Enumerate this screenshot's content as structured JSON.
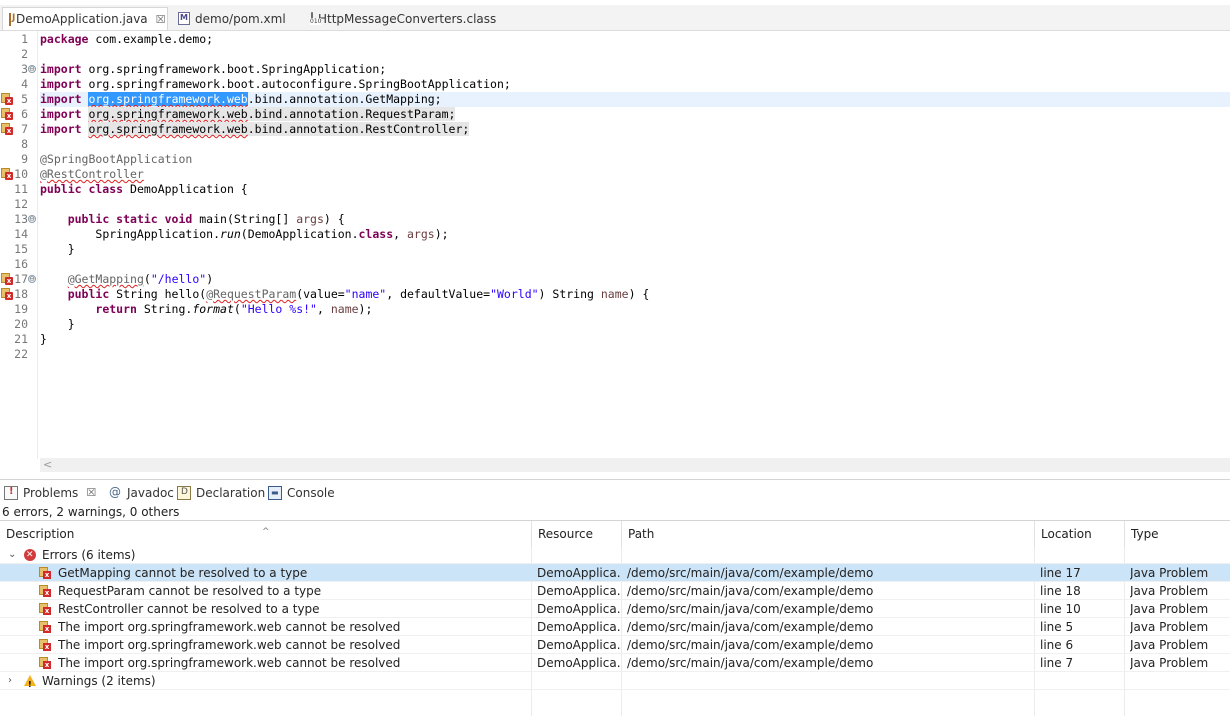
{
  "editor_tabs": [
    {
      "label": "DemoApplication.java",
      "icon": "java-file-icon",
      "active": true,
      "close": "☒"
    },
    {
      "label": "demo/pom.xml",
      "icon": "maven-file-icon",
      "active": false
    },
    {
      "label": "HttpMessageConverters.class",
      "icon": "class-file-icon",
      "active": false
    }
  ],
  "code": {
    "line_numbers": [
      "1",
      "2",
      "3",
      "4",
      "5",
      "6",
      "7",
      "8",
      "9",
      "10",
      "11",
      "12",
      "13",
      "14",
      "15",
      "16",
      "17",
      "18",
      "19",
      "20",
      "21",
      "22"
    ],
    "l1_kw": "package",
    "l1_rest": " com.example.demo;",
    "l3_kw": "import",
    "l3_rest": " org.springframework.boot.SpringApplication;",
    "l4_kw": "import",
    "l4_rest": " org.springframework.boot.autoconfigure.SpringBootApplication;",
    "l5_kw": "import",
    "l5_sel": "org.springframework.web",
    "l5_rest": ".bind.annotation.GetMapping;",
    "l6_kw": "import",
    "l6_err": "org.springframework.web",
    "l6_rest": ".bind.annotation.RequestParam;",
    "l7_kw": "import",
    "l7_err": "org.springframework.web",
    "l7_rest": ".bind.annotation.RestController;",
    "l9": "@SpringBootApplication",
    "l10": "@RestController",
    "l11_kw": "public class",
    "l11_rest": " DemoApplication {",
    "l13_kw": "public static void",
    "l13_rest": " main(String[] ",
    "l13_var": "args",
    "l13_end": ") {",
    "l14_a": "SpringApplication.",
    "l14_it": "run",
    "l14_b": "(DemoApplication.",
    "l14_kw": "class",
    "l14_c": ", ",
    "l14_var": "args",
    "l14_d": ");",
    "l15": "}",
    "l17_ann": "@GetMapping",
    "l17_b": "(",
    "l17_str": "\"/hello\"",
    "l17_c": ")",
    "l18_kw": "public",
    "l18_a": " String hello(",
    "l18_ann": "@RequestParam",
    "l18_b": "(value=",
    "l18_s1": "\"name\"",
    "l18_c": ", defaultValue=",
    "l18_s2": "\"World\"",
    "l18_d": ") String ",
    "l18_var": "name",
    "l18_e": ") {",
    "l19_kw": "return",
    "l19_a": " String.",
    "l19_it": "format",
    "l19_b": "(",
    "l19_str": "\"Hello %s!\"",
    "l19_c": ", ",
    "l19_var": "name",
    "l19_d": ");",
    "l20": "}",
    "l21": "}",
    "fold_glyph": "⊖"
  },
  "hscroll_arrow": "<",
  "view_tabs": [
    {
      "label": "Problems",
      "close": "☒"
    },
    {
      "label": "Javadoc"
    },
    {
      "label": "Declaration"
    },
    {
      "label": "Console"
    }
  ],
  "summary": "6 errors, 2 warnings, 0 others",
  "columns": [
    "Description",
    "Resource",
    "Path",
    "Location",
    "Type"
  ],
  "sort_caret": "^",
  "groups": {
    "errors": {
      "label": "Errors (6 items)",
      "twisty": "⌄"
    },
    "warnings": {
      "label": "Warnings (2 items)",
      "twisty": "›"
    }
  },
  "problems": [
    {
      "description": "GetMapping cannot be resolved to a type",
      "resource": "DemoApplica...",
      "path": "/demo/src/main/java/com/example/demo",
      "location": "line 17",
      "type": "Java Problem"
    },
    {
      "description": "RequestParam cannot be resolved to a type",
      "resource": "DemoApplica...",
      "path": "/demo/src/main/java/com/example/demo",
      "location": "line 18",
      "type": "Java Problem"
    },
    {
      "description": "RestController cannot be resolved to a type",
      "resource": "DemoApplica...",
      "path": "/demo/src/main/java/com/example/demo",
      "location": "line 10",
      "type": "Java Problem"
    },
    {
      "description": "The import org.springframework.web cannot be resolved",
      "resource": "DemoApplica...",
      "path": "/demo/src/main/java/com/example/demo",
      "location": "line 5",
      "type": "Java Problem"
    },
    {
      "description": "The import org.springframework.web cannot be resolved",
      "resource": "DemoApplica...",
      "path": "/demo/src/main/java/com/example/demo",
      "location": "line 6",
      "type": "Java Problem"
    },
    {
      "description": "The import org.springframework.web cannot be resolved",
      "resource": "DemoApplica...",
      "path": "/demo/src/main/java/com/example/demo",
      "location": "line 7",
      "type": "Java Problem"
    }
  ]
}
